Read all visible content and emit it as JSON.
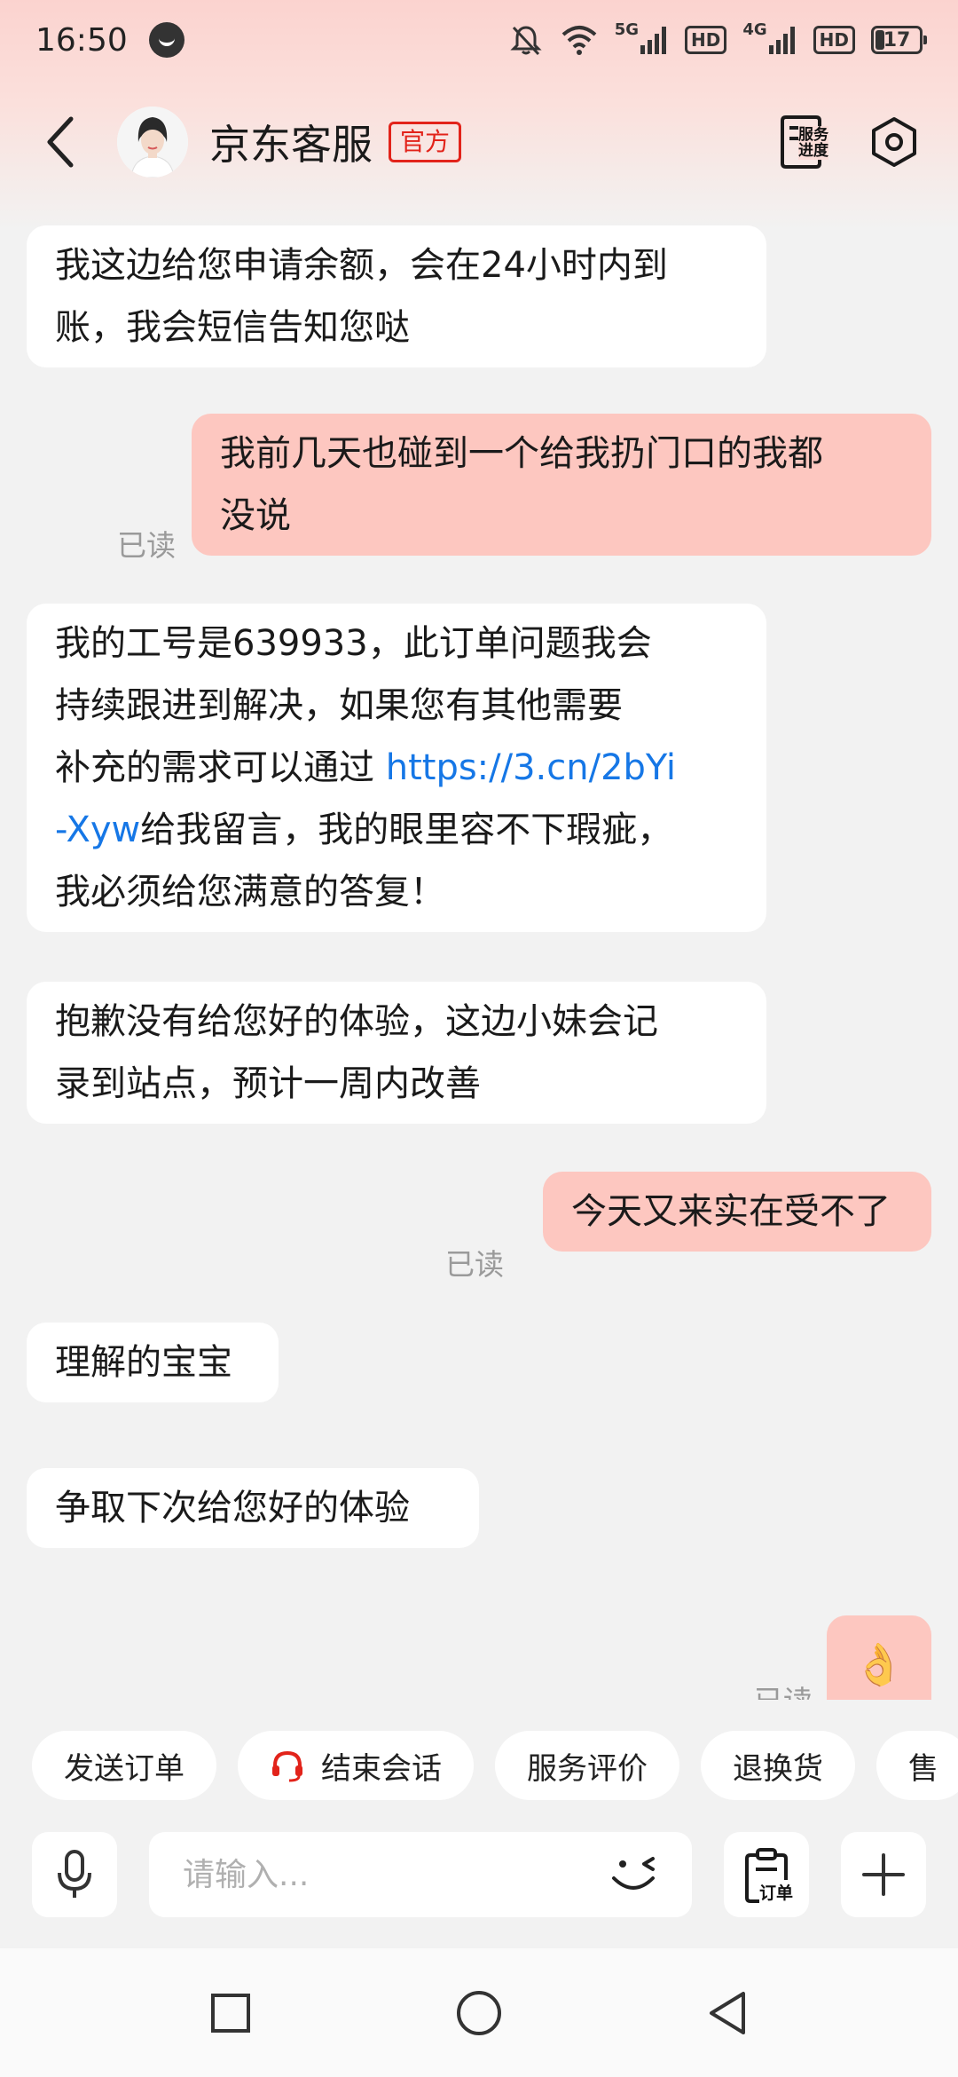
{
  "status_bar": {
    "time": "16:50",
    "net1": "5G",
    "net2": "4G",
    "hd1": "HD",
    "hd2": "HD",
    "battery": "17"
  },
  "header": {
    "title": "京东客服",
    "badge": "官方",
    "service_progress_line1": "服务",
    "service_progress_line2": "进度"
  },
  "messages": [
    {
      "side": "left",
      "lines": [
        "我这边给您申请余额，会在24小时内到",
        "账，我会短信告知您哒"
      ]
    },
    {
      "side": "right",
      "lines": [
        "我前几天也碰到一个给我扔门口的我都",
        "没说"
      ],
      "read": "已读"
    },
    {
      "side": "left",
      "lines": [
        "我的工号是639933，此订单问题我会",
        "持续跟进到解决，如果您有其他需要"
      ],
      "line3_prefix": "补充的需求可以通过 ",
      "link_part1": "https://3.cn/2bYi",
      "link_part2": "-Xyw",
      "line4_suffix": "给我留言，我的眼里容不下瑕疵，",
      "line5": "我必须给您满意的答复！"
    },
    {
      "side": "left",
      "lines": [
        "抱歉没有给您好的体验，这边小妹会记",
        "录到站点，预计一周内改善"
      ]
    },
    {
      "side": "right",
      "lines": [
        "今天又来实在受不了"
      ],
      "read": "已读"
    },
    {
      "side": "left",
      "lines": [
        "理解的宝宝"
      ]
    },
    {
      "side": "left",
      "lines": [
        "争取下次给您好的体验"
      ]
    },
    {
      "side": "right",
      "emoji": "👌",
      "read": "已读"
    }
  ],
  "quick_actions": [
    "发送订单",
    "结束会话",
    "服务评价",
    "退换货",
    "售"
  ],
  "input": {
    "placeholder": "请输入...",
    "order_label": "订单"
  },
  "colors": {
    "accent_red": "#e2231a",
    "link_blue": "#1677e6",
    "user_bubble": "#fdc7c0"
  }
}
